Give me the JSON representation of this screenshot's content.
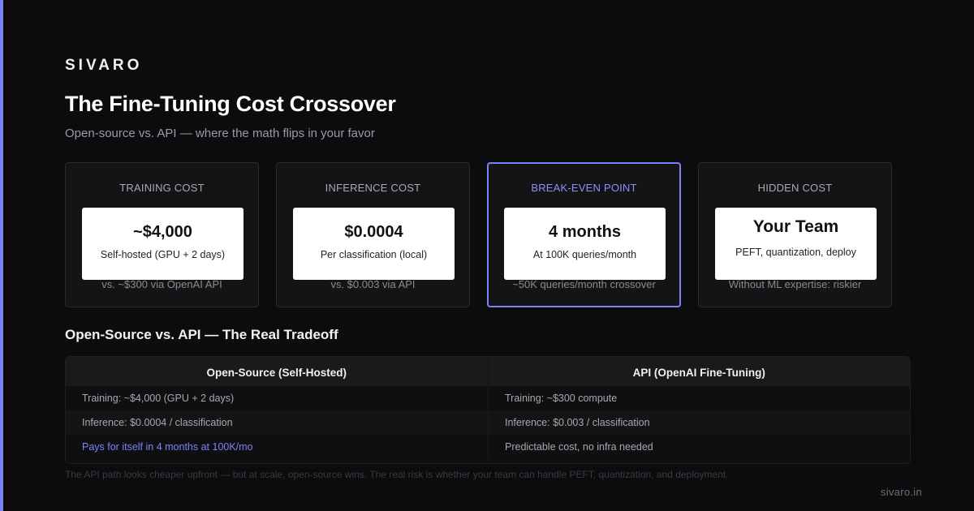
{
  "brand": "SIVARO",
  "title": "The Fine-Tuning Cost Crossover",
  "subtitle": "Open-source vs. API — where the math flips in your favor",
  "colors": {
    "accent": "#7c83f7",
    "background": "#0c0c0e",
    "card": "#141417"
  },
  "cards": [
    {
      "label": "TRAINING COST",
      "value": "~$4,000",
      "desc": "Self-hosted (GPU + 2 days)",
      "note": "vs. ~$300 via OpenAI API"
    },
    {
      "label": "INFERENCE COST",
      "value": "$0.0004",
      "desc": "Per classification (local)",
      "note": "vs. $0.003 via API"
    },
    {
      "label": "BREAK-EVEN POINT",
      "value": "4 months",
      "desc": "At 100K queries/month",
      "note": "~50K queries/month crossover"
    },
    {
      "label": "HIDDEN COST",
      "value": "Your Team",
      "desc": "PEFT, quantization, deploy",
      "note": "Without ML expertise: riskier"
    }
  ],
  "section_title": "Open-Source vs. API — The Real Tradeoff",
  "table": {
    "headers": [
      "Open-Source (Self-Hosted)",
      "API (OpenAI Fine-Tuning)"
    ],
    "rows": [
      [
        "Training: ~$4,000 (GPU + 2 days)",
        "Training: ~$300 compute"
      ],
      [
        "Inference: $0.0004 / classification",
        "Inference: $0.003 / classification"
      ],
      [
        "Pays for itself in 4 months at 100K/mo",
        "Predictable cost, no infra needed"
      ]
    ]
  },
  "footnote": "The API path looks cheaper upfront — but at scale, open-source wins. The real risk is whether your team can handle PEFT, quantization, and deployment.",
  "footer_url": "sivaro.in"
}
